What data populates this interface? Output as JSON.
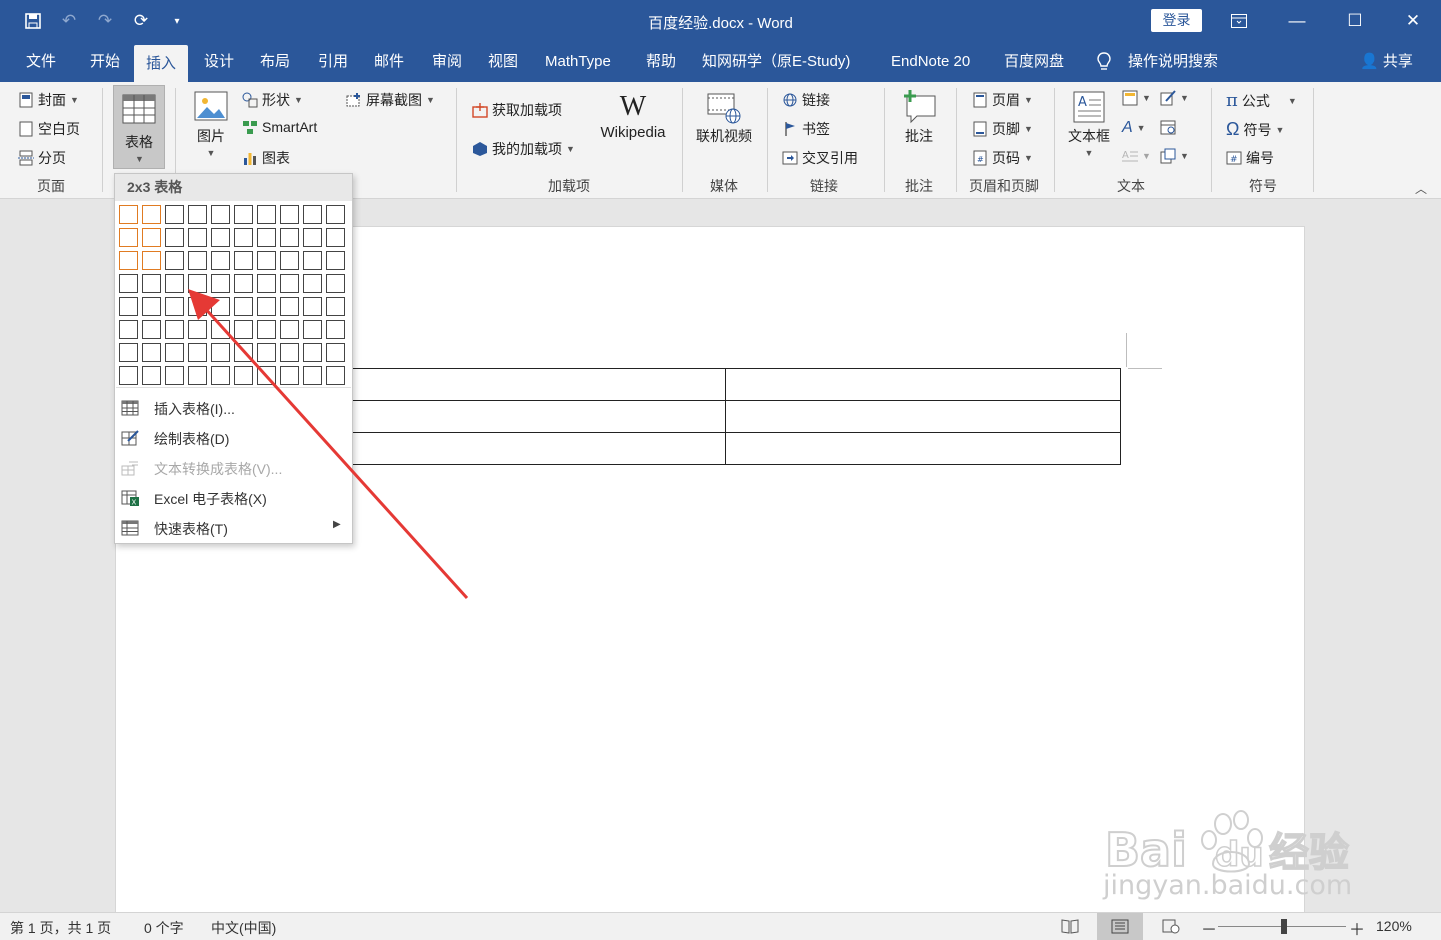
{
  "window": {
    "title": "百度经验.docx - Word",
    "login_label": "登录",
    "minimize": "—",
    "restore": "☐",
    "maximize": "☐",
    "close": "✕"
  },
  "menu": {
    "tabs": [
      "文件",
      "开始",
      "插入",
      "设计",
      "布局",
      "引用",
      "邮件",
      "审阅",
      "视图",
      "MathType",
      "帮助",
      "知网研学（原E-Study)",
      "EndNote 20",
      "百度网盘"
    ],
    "active_tab": "插入",
    "search_label": "操作说明搜索",
    "share_label": "共享"
  },
  "ribbon": {
    "pages": {
      "cover": "封面",
      "blank": "空白页",
      "break": "分页",
      "group": "页面"
    },
    "table": {
      "label": "表格"
    },
    "illustrations": {
      "picture": "图片",
      "shapes": "形状",
      "smartart": "SmartArt",
      "chart": "图表",
      "screenshot": "屏幕截图"
    },
    "addins": {
      "get": "获取加载项",
      "mine": "我的加载项",
      "wikipedia": "Wikipedia",
      "group": "加载项"
    },
    "media": {
      "online_video": "联机视频",
      "group": "媒体"
    },
    "links": {
      "link": "链接",
      "bookmark": "书签",
      "crossref": "交叉引用",
      "group": "链接"
    },
    "comments": {
      "comment": "批注",
      "group": "批注"
    },
    "header_footer": {
      "header": "页眉",
      "footer": "页脚",
      "page_number": "页码",
      "group": "页眉和页脚"
    },
    "text": {
      "textbox": "文本框",
      "group": "文本"
    },
    "symbols": {
      "equation": "公式",
      "symbol": "符号",
      "numbering": "编号",
      "group": "符号"
    }
  },
  "dropdown": {
    "header": "2x3 表格",
    "grid_cols": 10,
    "grid_rows": 8,
    "selected_cols": 2,
    "selected_rows": 3,
    "items": [
      {
        "label": "插入表格(I)...",
        "disabled": false
      },
      {
        "label": "绘制表格(D)",
        "disabled": false
      },
      {
        "label": "文本转换成表格(V)...",
        "disabled": true
      },
      {
        "label": "Excel 电子表格(X)",
        "disabled": false
      },
      {
        "label": "快速表格(T)",
        "disabled": false
      }
    ]
  },
  "status": {
    "page": "第 1 页，共 1 页",
    "words": "0 个字",
    "language": "中文(中国)",
    "zoom": "120%",
    "zoom_minus": "－",
    "zoom_plus": "＋"
  },
  "watermark": {
    "text": "jingyan.baidu.com"
  },
  "colors": {
    "brand": "#2b579a",
    "selection": "#e07b22",
    "arrow": "#e53935"
  }
}
